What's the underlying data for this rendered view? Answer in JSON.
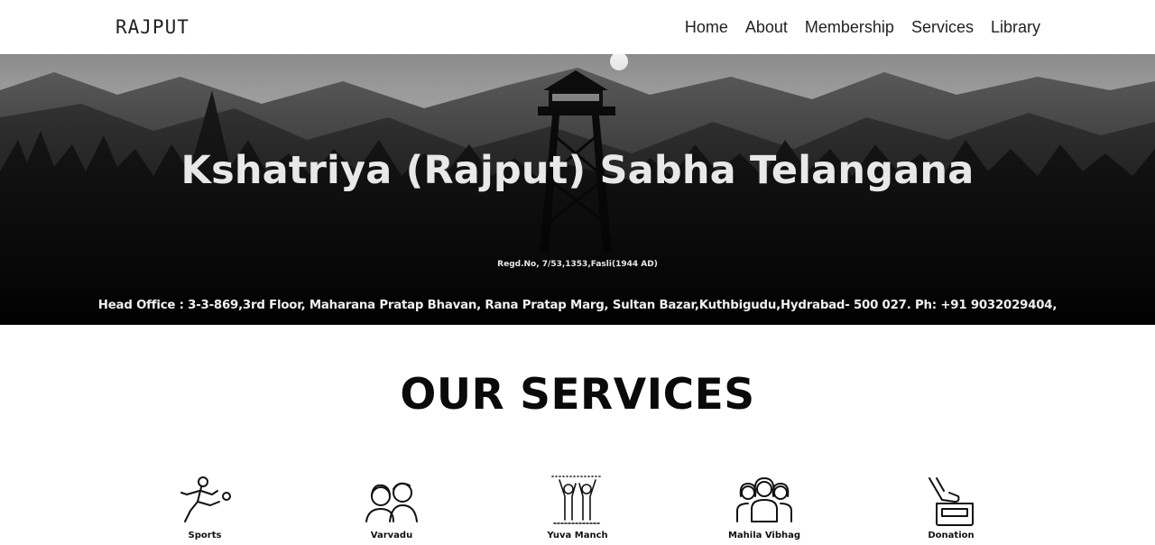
{
  "navbar": {
    "brand": "RAJPUT",
    "links": [
      {
        "label": "Home"
      },
      {
        "label": "About"
      },
      {
        "label": "Membership"
      },
      {
        "label": "Services"
      },
      {
        "label": "Library"
      }
    ]
  },
  "hero": {
    "title": "Kshatriya (Rajput) Sabha Telangana",
    "registration": "Regd.No, 7/53,1353,Fasli(1944 AD)",
    "address": "Head Office : 3-3-869,3rd Floor, Maharana Pratap Bhavan, Rana Pratap Marg, Sultan Bazar,Kuthbigudu,Hydrabad- 500 027. Ph: +91 9032029404,"
  },
  "services": {
    "heading": "OUR SERVICES",
    "items": [
      {
        "label": "Sports",
        "icon": "sports-icon"
      },
      {
        "label": "Varvadu",
        "icon": "couple-icon"
      },
      {
        "label": "Yuva Manch",
        "icon": "youth-icon"
      },
      {
        "label": "Mahila Vibhag",
        "icon": "women-group-icon"
      },
      {
        "label": "Donation",
        "icon": "donation-icon"
      }
    ]
  }
}
